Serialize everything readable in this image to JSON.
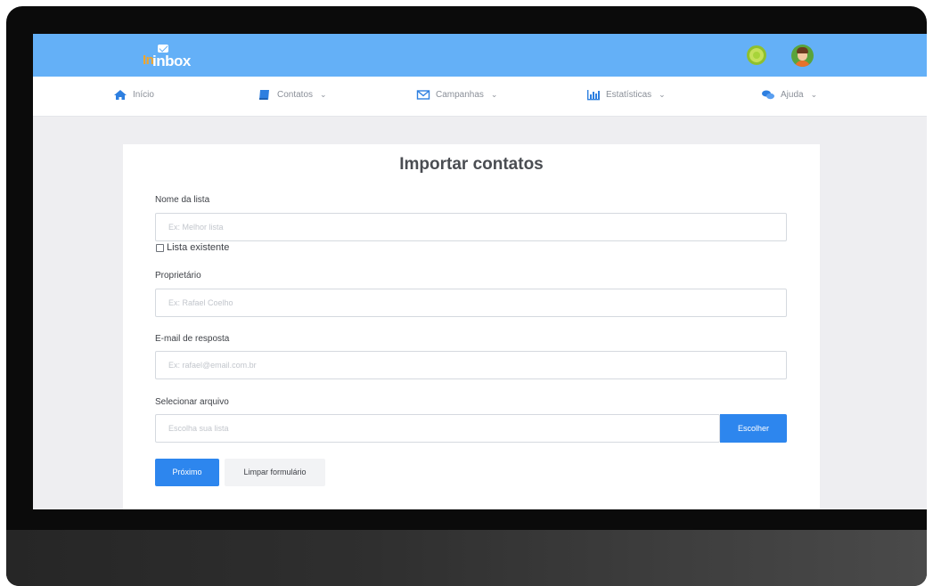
{
  "app": {
    "logo_prefix": "In",
    "logo_name": "inbox"
  },
  "nav": {
    "items": [
      {
        "label": "Início",
        "icon": "home-icon",
        "dropdown": false
      },
      {
        "label": "Contatos",
        "icon": "address-book-icon",
        "dropdown": true
      },
      {
        "label": "Campanhas",
        "icon": "envelope-icon",
        "dropdown": true
      },
      {
        "label": "Estatísticas",
        "icon": "bar-chart-icon",
        "dropdown": true
      },
      {
        "label": "Ajuda",
        "icon": "chat-bubbles-icon",
        "dropdown": true
      }
    ]
  },
  "form": {
    "title": "Importar contatos",
    "list_name": {
      "label": "Nome da lista",
      "placeholder": "Ex: Melhor lista",
      "value": ""
    },
    "existing_list": {
      "label": "Lista existente",
      "checked": false
    },
    "owner": {
      "label": "Proprietário",
      "placeholder": "Ex: Rafael Coelho",
      "value": ""
    },
    "reply_email": {
      "label": "E-mail de resposta",
      "placeholder": "Ex: rafael@email.com.br",
      "value": ""
    },
    "file": {
      "label": "Selecionar arquivo",
      "placeholder": "Escolha sua lista",
      "button": "Escolher"
    },
    "next_button": "Próximo",
    "clear_button": "Limpar formulário"
  },
  "colors": {
    "header": "#64b0f7",
    "primary": "#2d86ee",
    "page_bg": "#eeeef1",
    "nav_icon": "#2d7fe0"
  }
}
